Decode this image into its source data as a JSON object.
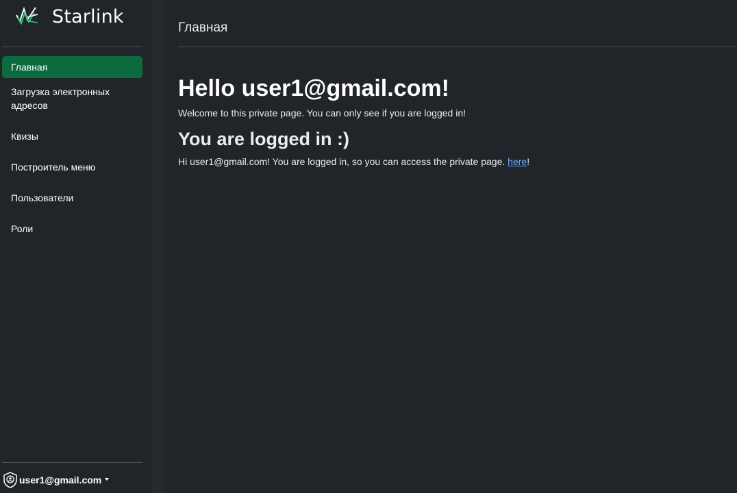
{
  "brand": {
    "name": "Starlink",
    "logo_icon": "starlink-logo",
    "colors": {
      "accent": "#2ecc71",
      "white": "#ffffff"
    }
  },
  "sidebar": {
    "items": [
      {
        "label": "Главная",
        "active": true
      },
      {
        "label": "Загрузка электронных адресов",
        "active": false
      },
      {
        "label": "Квизы",
        "active": false
      },
      {
        "label": "Построитель меню",
        "active": false
      },
      {
        "label": "Пользователи",
        "active": false
      },
      {
        "label": "Роли",
        "active": false
      }
    ],
    "active_color": "#0b6b3e",
    "user": {
      "email": "user1@gmail.com",
      "icon": "user-shield-icon"
    }
  },
  "main": {
    "header": "Главная",
    "hello": "Hello user1@gmail.com!",
    "welcome": "Welcome to this private page. You can only see if you are logged in!",
    "logged_title": "You are logged in :)",
    "hi_prefix": "Hi user1@gmail.com! You are logged in, so you can access the private page. ",
    "link_text": "here",
    "hi_suffix": "!",
    "link_color": "#6ea8fe"
  }
}
